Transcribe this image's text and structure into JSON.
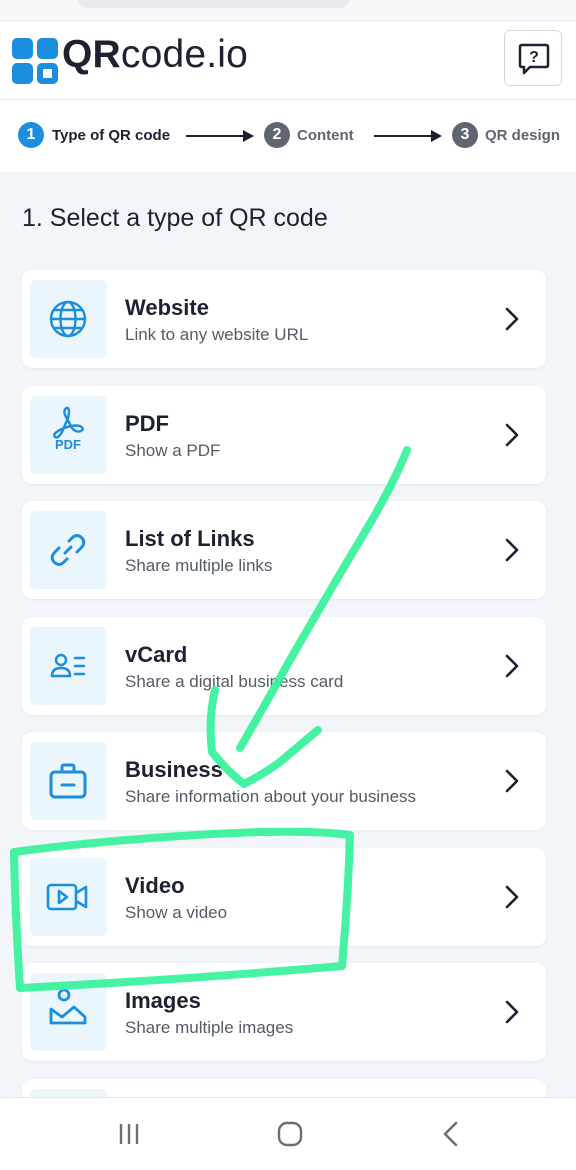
{
  "app": {
    "logo_text_bold": "QR",
    "logo_text_light": "code.io"
  },
  "steps": [
    {
      "number": "1",
      "label": "Type of QR code",
      "active": true
    },
    {
      "number": "2",
      "label": "Content",
      "active": false
    },
    {
      "number": "3",
      "label": "QR design",
      "active": false
    }
  ],
  "section_title": "1. Select a type of QR code",
  "types": [
    {
      "title": "Website",
      "subtitle": "Link to any website URL",
      "icon": "globe-icon"
    },
    {
      "title": "PDF",
      "subtitle": "Show a PDF",
      "icon": "pdf-icon",
      "icon_caption": "PDF"
    },
    {
      "title": "List of Links",
      "subtitle": "Share multiple links",
      "icon": "link-icon"
    },
    {
      "title": "vCard",
      "subtitle": "Share a digital business card",
      "icon": "contact-card-icon"
    },
    {
      "title": "Business",
      "subtitle": "Share information about your business",
      "icon": "briefcase-icon"
    },
    {
      "title": "Video",
      "subtitle": "Show a video",
      "icon": "video-camera-icon"
    },
    {
      "title": "Images",
      "subtitle": "Share multiple images",
      "icon": "image-icon"
    }
  ],
  "colors": {
    "accent": "#1b8ee0",
    "active_step": "#1b8ee0",
    "inactive_step": "#5f6672",
    "annotation": "#35f29a",
    "icon_bg": "#eaf5fc"
  },
  "navbar": {
    "icons": [
      "recent-apps-icon",
      "home-icon",
      "back-icon"
    ]
  }
}
